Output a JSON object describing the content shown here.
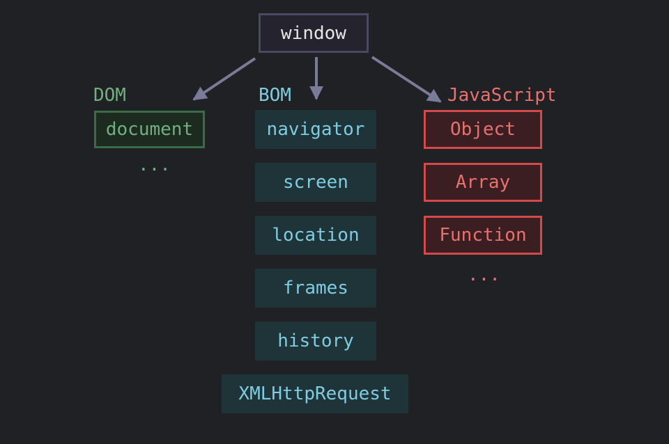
{
  "root": {
    "label": "window"
  },
  "groups": {
    "dom": {
      "title": "DOM",
      "items": [
        "document"
      ],
      "ellipsis": "..."
    },
    "bom": {
      "title": "BOM",
      "items": [
        "navigator",
        "screen",
        "location",
        "frames",
        "history",
        "XMLHttpRequest"
      ]
    },
    "javascript": {
      "title": "JavaScript",
      "items": [
        "Object",
        "Array",
        "Function"
      ],
      "ellipsis": "..."
    }
  },
  "colors": {
    "background": "#202124",
    "arrow": "#7a7a99",
    "root_border": "#4a4862",
    "root_fill": "#25242e",
    "root_text": "#e6e6e6",
    "dom_text": "#6fb07e",
    "dom_border": "#3c6b47",
    "dom_fill": "#1c2a20",
    "bom_text": "#7fcce0",
    "bom_fill": "#1f3438",
    "js_text": "#e8716e",
    "js_border": "#d44a4a",
    "js_fill": "#3a1e21"
  }
}
